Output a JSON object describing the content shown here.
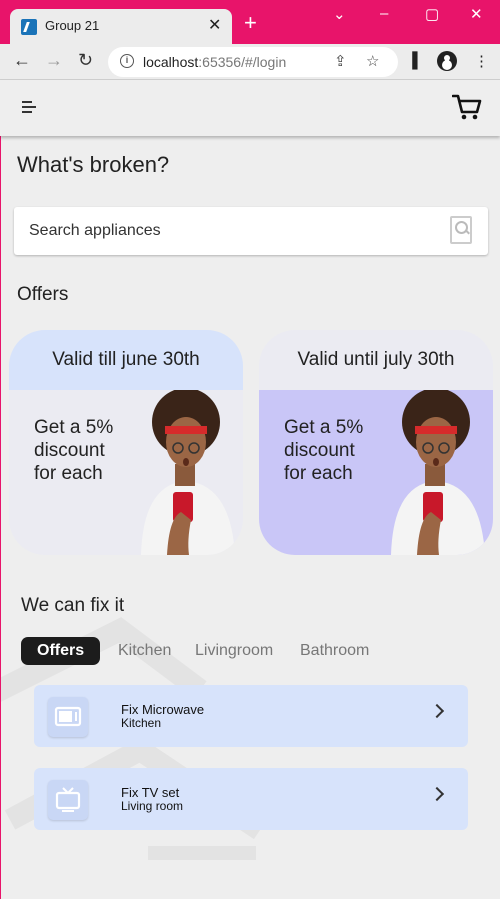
{
  "browser": {
    "tab_title": "Group 21",
    "tab_close": "✕",
    "new_tab": "+",
    "url_host": "localhost",
    "url_rest": ":65356/#/login",
    "window_controls": [
      "⌄",
      "–",
      "▢",
      "✕"
    ]
  },
  "app": {
    "page_title": "What's broken?",
    "search_placeholder": "Search appliances",
    "offers_title": "Offers",
    "offers": [
      {
        "validity": "Valid till june 30th",
        "text": "Get a 5% discount for each"
      },
      {
        "validity": "Valid until july 30th",
        "text": "Get a 5% discount for each"
      }
    ],
    "fix_title": "We can fix it",
    "categories": [
      "Offers",
      "Kitchen",
      "Livingroom",
      "Bathroom"
    ],
    "services": [
      {
        "title": "Fix Microwave",
        "subtitle": "Kitchen",
        "icon": "microwave-icon"
      },
      {
        "title": "Fix TV set",
        "subtitle": "Living room",
        "icon": "tv-icon"
      }
    ]
  },
  "colors": {
    "browser_frame": "#e8146a",
    "card_lavender": "#c9c6f7",
    "card_blue": "#d7e3fb",
    "chip_active": "#1c1c1c"
  }
}
